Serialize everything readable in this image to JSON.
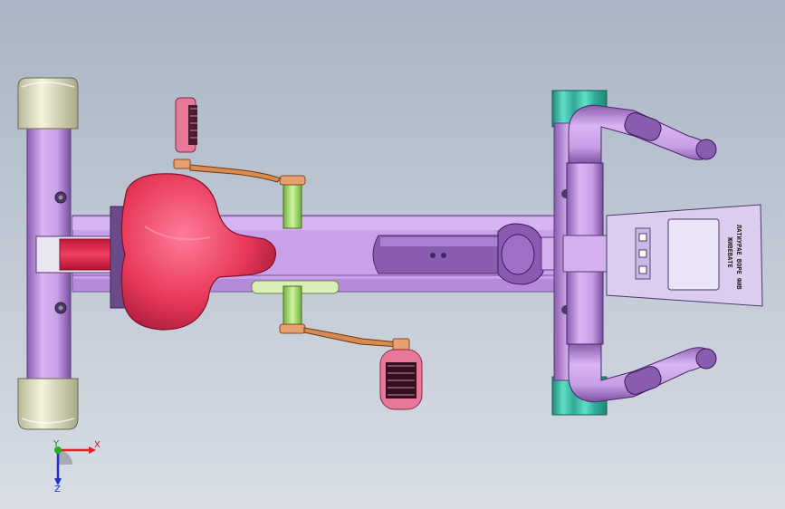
{
  "viewport": {
    "background_top": "#aab4c4",
    "background_bottom": "#d8dde5"
  },
  "model": {
    "console": {
      "line1": "ЖИВЕВАТЕ",
      "line2": "ЛАТИУРАЕ ВОРЕ ФИВ"
    }
  },
  "colors": {
    "frame": "#c89ee6",
    "frame_dark": "#9a6ec0",
    "seat": "#e8385a",
    "end_cap": "#e8e8c8",
    "foot_pad": "#40c8b0",
    "pedal": "#e87898",
    "crank_axle": "#a8e070",
    "copper": "#d88a50",
    "console_panel": "#dccdf0"
  },
  "triad": {
    "x_label": "X",
    "y_label": "Y",
    "z_label": "Z"
  }
}
